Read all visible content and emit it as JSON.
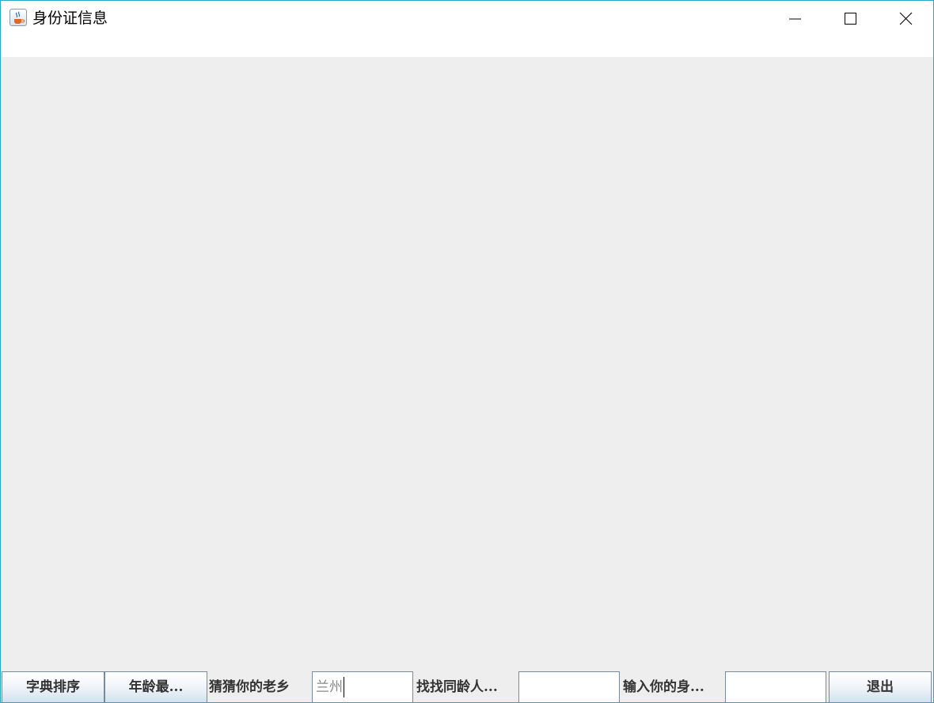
{
  "window": {
    "title": "身份证信息",
    "app_icon": "java-coffee-icon",
    "border_color": "#2aa7c0",
    "controls": [
      "minimize-icon",
      "maximize-icon",
      "close-icon"
    ]
  },
  "toolbar": {
    "sort_dict_label": "字典排序",
    "age_max_label": "年龄最...",
    "guess_hometown_label": "猜猜你的老乡",
    "hometown_value": "兰州",
    "find_same_age_label": "找找同龄人...",
    "same_age_value": "",
    "input_id_label": "输入你的身...",
    "id_value": "",
    "exit_label": "退出"
  }
}
